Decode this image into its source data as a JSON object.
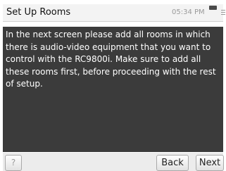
{
  "header": {
    "title": "Set Up Rooms",
    "time": "05:34 PM"
  },
  "main": {
    "message": "In the next screen please add all rooms in which there is audio-video equipment that you want to control with the RC9800i. Make sure to add all these rooms first, before proceeding with the rest of setup."
  },
  "footer": {
    "help_label": "?",
    "back_label": "Back",
    "next_label": "Next"
  }
}
